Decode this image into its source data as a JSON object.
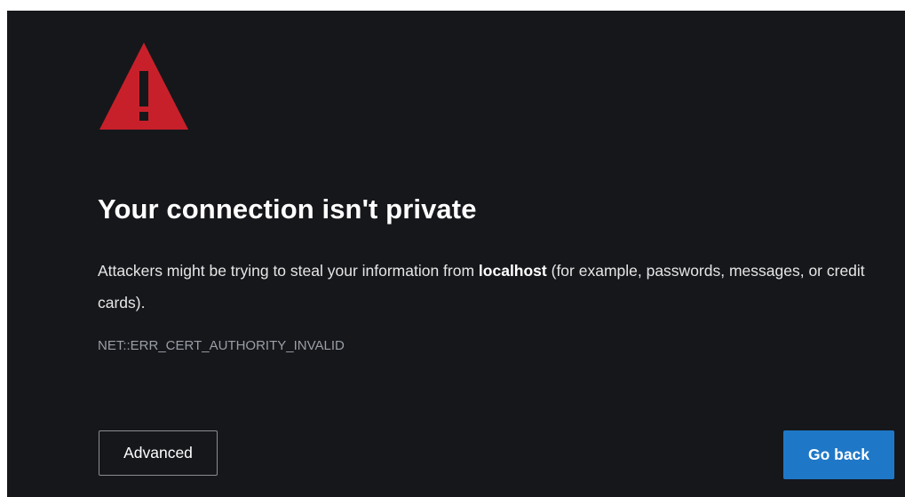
{
  "warning": {
    "icon": "warning-triangle-icon",
    "color": "#c8202a"
  },
  "title": "Your connection isn't private",
  "message": {
    "before": "Attackers might be trying to steal your information from ",
    "host": "localhost",
    "after": " (for example, passwords, messages, or credit cards)."
  },
  "error_code": "NET::ERR_CERT_AUTHORITY_INVALID",
  "buttons": {
    "advanced_label": "Advanced",
    "go_back_label": "Go back",
    "go_back_color": "#1f78c7"
  },
  "colors": {
    "background": "#16171b",
    "text": "#ffffff",
    "muted": "#9a9ea6"
  }
}
